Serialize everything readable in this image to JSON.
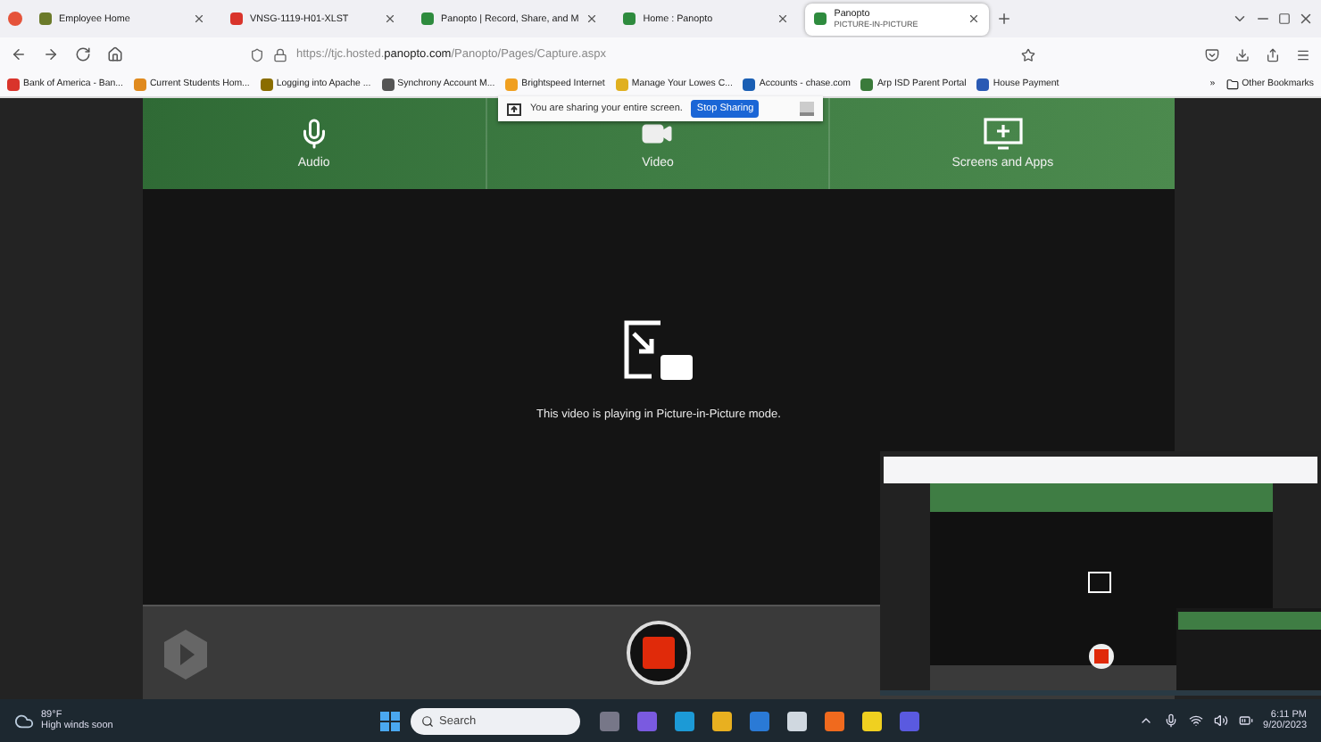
{
  "tabs": [
    {
      "title": "Employee Home",
      "color": "#6b7a2a",
      "selected": false
    },
    {
      "title": "VNSG-1119-H01-XLST",
      "color": "#d9342b",
      "selected": false
    },
    {
      "title": "Panopto | Record, Share, and M",
      "color": "#2e8b3e",
      "selected": false
    },
    {
      "title": "Home : Panopto",
      "color": "#2e8b3e",
      "selected": false
    },
    {
      "title": "Panopto",
      "subtitle": "PICTURE-IN-PICTURE",
      "color": "#2e8b3e",
      "selected": true
    }
  ],
  "address": {
    "prefix": "https://tjc.hosted.",
    "domain": "panopto.com",
    "path": "/Panopto/Pages/Capture.aspx"
  },
  "bookmarks": [
    {
      "title": "Bank of America - Ban...",
      "color": "#d9342b"
    },
    {
      "title": "Current Students Hom...",
      "color": "#e08a1e"
    },
    {
      "title": "Logging into Apache ...",
      "color": "#8a6d00"
    },
    {
      "title": "Synchrony Account M...",
      "color": "#555555"
    },
    {
      "title": "Brightspeed Internet",
      "color": "#f0a020"
    },
    {
      "title": "Manage Your Lowes C...",
      "color": "#e0b020"
    },
    {
      "title": "Accounts - chase.com",
      "color": "#1a5fb4"
    },
    {
      "title": "Arp ISD Parent Portal",
      "color": "#3a7a3a"
    },
    {
      "title": "House Payment",
      "color": "#2a5ab4"
    }
  ],
  "bookmarks_more": "»",
  "other_bookmarks": "Other Bookmarks",
  "sharing": {
    "message": "You are sharing your entire screen.",
    "button": "Stop Sharing"
  },
  "sources": [
    {
      "label": "Audio",
      "kind": "mic"
    },
    {
      "label": "Video",
      "kind": "camera"
    },
    {
      "label": "Screens and Apps",
      "kind": "screen"
    }
  ],
  "pip_message": "This video is playing in Picture-in-Picture mode.",
  "taskbar": {
    "temperature": "89°F",
    "weather": "High winds soon",
    "search_placeholder": "Search",
    "time": "6:11 PM",
    "date": "9/20/2023"
  }
}
